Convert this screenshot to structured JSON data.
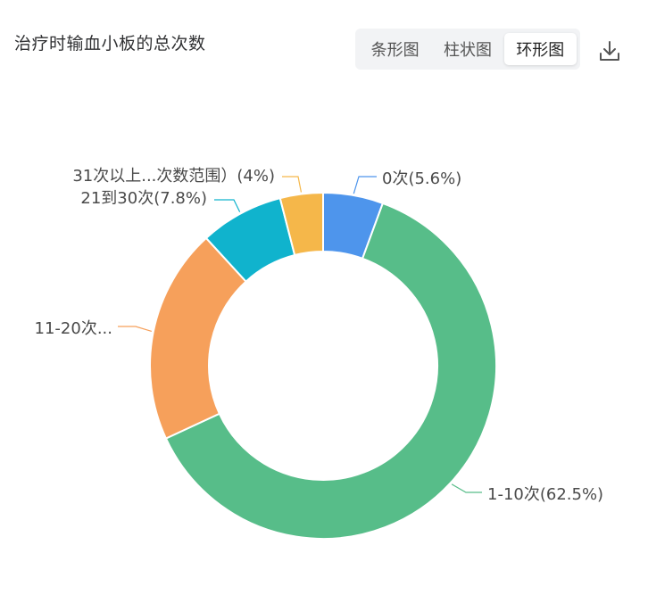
{
  "header": {
    "title": "治疗时输血小板的总次数",
    "tabs": [
      {
        "label": "条形图",
        "active": false
      },
      {
        "label": "柱状图",
        "active": false
      },
      {
        "label": "环形图",
        "active": true
      }
    ],
    "download_icon": "download-icon"
  },
  "chart_data": {
    "type": "pie",
    "variant": "donut",
    "title": "治疗时输血小板的总次数",
    "slices": [
      {
        "name": "0次",
        "percent": 5.6,
        "color": "#4e95ec",
        "label": "0次(5.6%)"
      },
      {
        "name": "1-10次",
        "percent": 62.5,
        "color": "#57bd89",
        "label": "1-10次(62.5%)"
      },
      {
        "name": "11-20次",
        "percent": 20.1,
        "color": "#f6a05b",
        "label": "11-20次..."
      },
      {
        "name": "21到30次",
        "percent": 7.8,
        "color": "#10b3cd",
        "label": "21到30次(7.8%)"
      },
      {
        "name": "31次以上",
        "percent": 4,
        "color": "#f5b74a",
        "label": "31次以上...次数范围）(4%)"
      }
    ]
  }
}
